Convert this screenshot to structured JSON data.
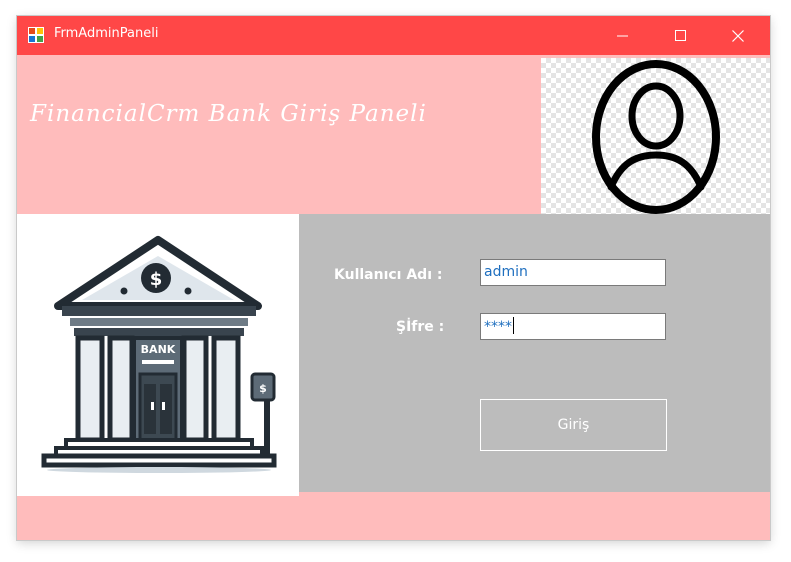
{
  "window": {
    "title": "FrmAdminPaneli",
    "titlebar_color": "#ff4747",
    "background_color": "#ffbcbc"
  },
  "header": {
    "title": "FinancialCrm Bank Giriş Paneli",
    "avatar_icon": "user-avatar-icon"
  },
  "illustration": {
    "icon": "bank-building-icon",
    "sign_text": "BANK",
    "symbol": "$"
  },
  "login": {
    "panel_color": "#bcbcbc",
    "username_label": "Kullanıcı Adı :",
    "username_value": "admin",
    "password_label": "Şİfre :",
    "password_value": "****",
    "submit_label": "Giriş"
  }
}
